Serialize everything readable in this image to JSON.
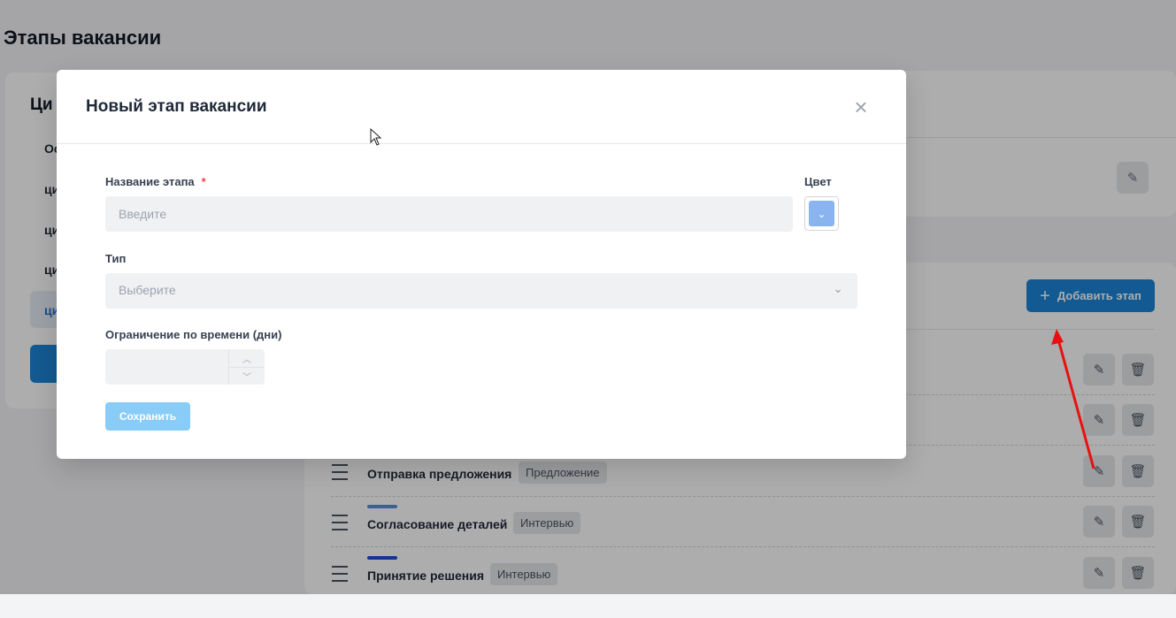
{
  "page": {
    "title": "Этапы вакансии"
  },
  "left_panel": {
    "title": "Ци",
    "items": [
      "Ос",
      "ци",
      "ци",
      "ци",
      "ци"
    ]
  },
  "stages": [
    {
      "name": "Отправка предложения",
      "type": "Предложение",
      "color": "#1d4ed8"
    },
    {
      "name": "Согласование деталей",
      "type": "Интервью",
      "color": "#5b8de0"
    },
    {
      "name": "Принятие решения",
      "type": "Интервью",
      "color": "#1d4ed8"
    }
  ],
  "toolbar": {
    "add_stage_label": "Добавить этап"
  },
  "modal": {
    "title": "Новый этап вакансии",
    "name_label": "Название этапа",
    "required_mark": "*",
    "name_placeholder": "Введите",
    "color_label": "Цвет",
    "selected_color": "#8ab4f0",
    "type_label": "Тип",
    "type_placeholder": "Выберите",
    "time_limit_label": "Ограничение по времени (дни)",
    "time_limit_value": "",
    "save_label": "Сохранить"
  },
  "icons": {
    "close": "×",
    "chevron": "⌄",
    "edit": "✎",
    "trash": "🗑",
    "plus": "+",
    "up": "︿",
    "down": "﹀"
  }
}
